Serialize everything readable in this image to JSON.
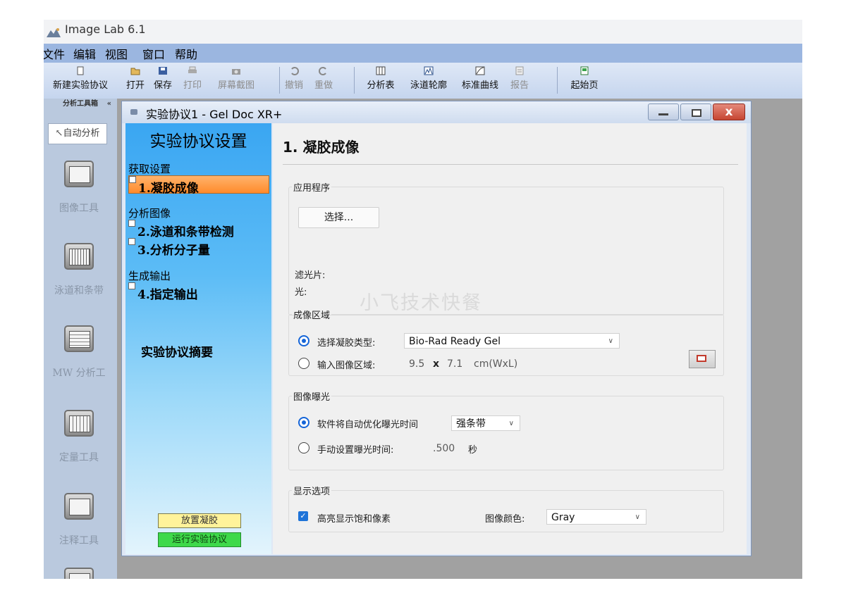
{
  "app": {
    "title": "Image Lab 6.1"
  },
  "menu": [
    "文件",
    "编辑",
    "视图",
    "窗口",
    "帮助"
  ],
  "toolbar": [
    {
      "label": "新建实验协议",
      "icon": "new-document-icon",
      "disabled": false
    },
    {
      "label": "打开",
      "icon": "folder-open-icon",
      "disabled": false
    },
    {
      "label": "保存",
      "icon": "save-icon",
      "disabled": false
    },
    {
      "label": "打印",
      "icon": "print-icon",
      "disabled": true
    },
    {
      "label": "屏幕截图",
      "icon": "camera-icon",
      "disabled": true
    },
    {
      "label": "撤销",
      "icon": "undo-icon",
      "disabled": true
    },
    {
      "label": "重做",
      "icon": "redo-icon",
      "disabled": true
    },
    {
      "label": "分析表",
      "icon": "analysis-table-icon",
      "disabled": false
    },
    {
      "label": "泳道轮廓",
      "icon": "lane-profile-icon",
      "disabled": false
    },
    {
      "label": "标准曲线",
      "icon": "standard-curve-icon",
      "disabled": false
    },
    {
      "label": "报告",
      "icon": "report-icon",
      "disabled": true
    },
    {
      "label": "起始页",
      "icon": "start-page-icon",
      "disabled": false
    }
  ],
  "toolbox": {
    "header": "分析工具箱",
    "collapse": "«",
    "auto_analysis": "自动分析",
    "tools": [
      {
        "label": "图像工具",
        "icon": "image-tools-icon"
      },
      {
        "label": "泳道和条带",
        "icon": "lanes-bands-icon"
      },
      {
        "label": "MW 分析工",
        "icon": "mw-analysis-icon"
      },
      {
        "label": "定量工具",
        "icon": "quantity-tools-icon"
      },
      {
        "label": "注释工具",
        "icon": "annotation-tools-icon"
      }
    ]
  },
  "window": {
    "title": "实验协议1 - Gel Doc XR+",
    "close_label": "x"
  },
  "steps": {
    "title": "实验协议设置",
    "group_acquire": "获取设置",
    "step1": "1.凝胶成像",
    "group_analyze": "分析图像",
    "step2": "2.泳道和条带检测",
    "step3": "3.分析分子量",
    "group_output": "生成输出",
    "step4": "4.指定输出",
    "summary": "实验协议摘要",
    "place_gel": "放置凝胶",
    "run_protocol": "运行实验协议"
  },
  "content": {
    "heading": "1. 凝胶成像",
    "application": {
      "legend": "应用程序",
      "select_button": "选择...",
      "filter_label": "滤光片:",
      "light_label": "光:"
    },
    "imaging_area": {
      "legend": "成像区域",
      "option_gel_type": "选择凝胶类型:",
      "gel_type_value": "Bio-Rad Ready Gel",
      "option_area": "输入图像区域:",
      "width": "9.5",
      "times": "x",
      "length": "7.1",
      "unit": "cm(WxL)"
    },
    "exposure": {
      "legend": "图像曝光",
      "option_auto": "软件将自动优化曝光时间",
      "auto_value": "强条带",
      "option_manual": "手动设置曝光时间:",
      "manual_value": ".500",
      "manual_unit": "秒"
    },
    "display": {
      "legend": "显示选项",
      "highlight_label": "高亮显示饱和像素",
      "image_color_label": "图像颜色:",
      "image_color_value": "Gray"
    }
  },
  "watermark": "小飞技术快餐"
}
